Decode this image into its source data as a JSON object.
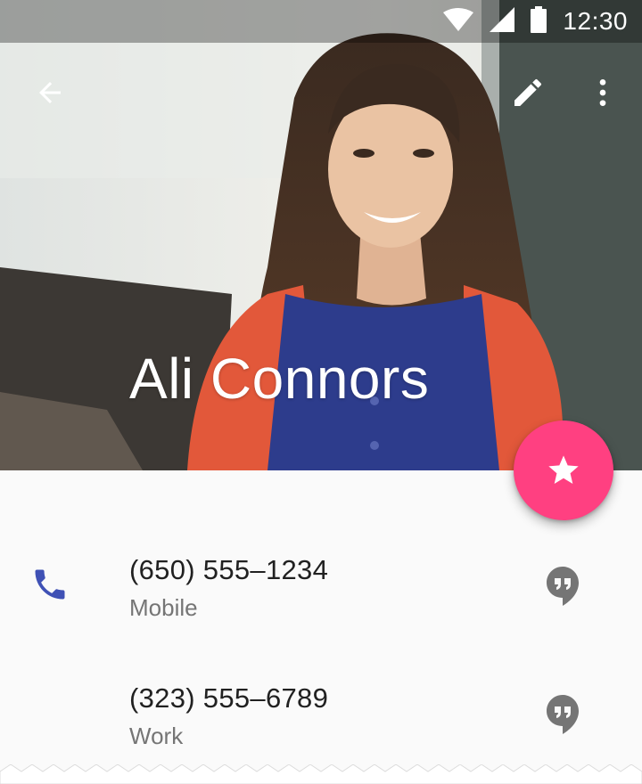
{
  "status_bar": {
    "time": "12:30",
    "icons": [
      "wifi-icon",
      "cell-signal-icon",
      "battery-icon"
    ]
  },
  "toolbar": {
    "back_icon": "arrow-back-icon",
    "edit_icon": "pencil-icon",
    "more_icon": "more-vert-icon"
  },
  "contact": {
    "name": "Ali Connors"
  },
  "fab": {
    "icon": "star-icon",
    "color": "#ff4081"
  },
  "phones": [
    {
      "number": "(650) 555–1234",
      "type": "Mobile",
      "leading_icon": "phone-icon",
      "action_icon": "hangouts-icon"
    },
    {
      "number": "(323) 555–6789",
      "type": "Work",
      "action_icon": "hangouts-icon"
    }
  ],
  "colors": {
    "accent": "#ff4081",
    "primary_icon": "#3f51b5",
    "secondary_icon": "#757575",
    "text_primary": "#212121",
    "text_secondary": "#757575",
    "background": "#fafafa"
  }
}
